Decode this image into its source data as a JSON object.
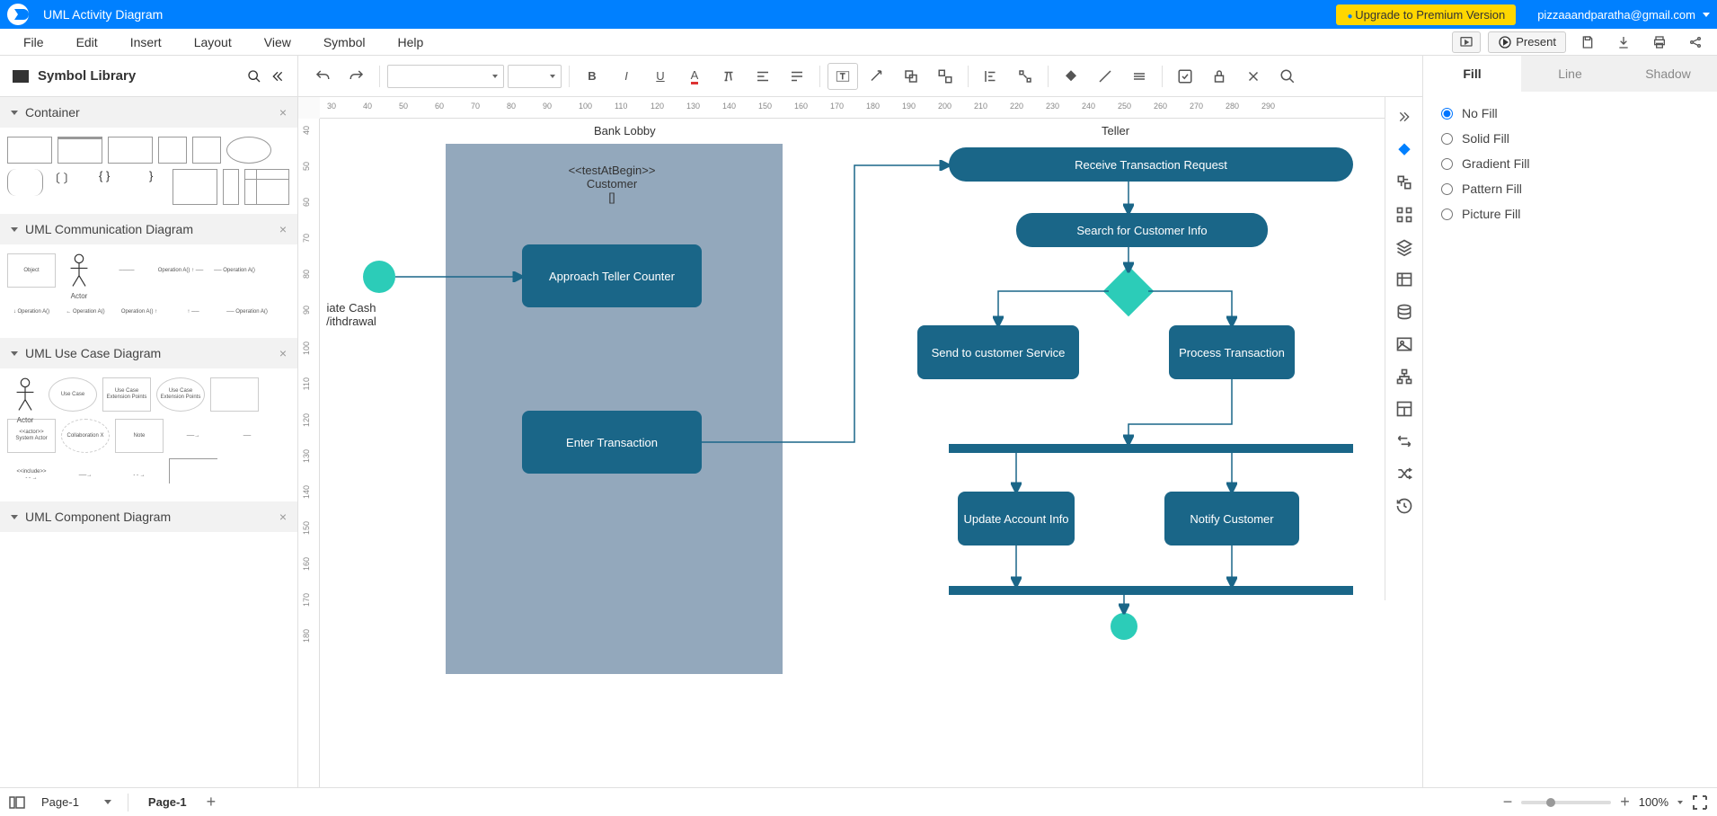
{
  "topbar": {
    "title": "UML Activity Diagram",
    "upgrade": "Upgrade to Premium Version",
    "user": "pizzaaandparatha@gmail.com"
  },
  "menus": [
    "File",
    "Edit",
    "Insert",
    "Layout",
    "View",
    "Symbol",
    "Help"
  ],
  "present_label": "Present",
  "left": {
    "header": "Symbol Library",
    "sections": [
      {
        "name": "Container"
      },
      {
        "name": "UML Communication Diagram"
      },
      {
        "name": "UML Use Case Diagram"
      },
      {
        "name": "UML Component Diagram"
      }
    ]
  },
  "canvas": {
    "lanes": [
      "Bank Lobby",
      "Teller"
    ],
    "test_header": {
      "stereotype": "<<testAtBegin>>",
      "role": "Customer",
      "body": "[]"
    },
    "side_text": {
      "l1": "iate Cash",
      "l2": "/ithdrawal"
    },
    "nodes": {
      "approach": "Approach Teller Counter",
      "enter": "Enter Transaction",
      "receive": "Receive Transaction Request",
      "search": "Search for Customer Info",
      "send": "Send to customer Service",
      "process": "Process Transaction",
      "update": "Update Account Info",
      "notify": "Notify Customer"
    }
  },
  "right_tabs": [
    "Fill",
    "Line",
    "Shadow"
  ],
  "fill_options": [
    "No Fill",
    "Solid Fill",
    "Gradient Fill",
    "Pattern Fill",
    "Picture Fill"
  ],
  "status": {
    "page_sel": "Page-1",
    "page_tab": "Page-1",
    "zoom": "100%"
  },
  "ruler_h": [
    30,
    40,
    50,
    60,
    70,
    80,
    90,
    100,
    110,
    120,
    130,
    140,
    150,
    160,
    170,
    180,
    190,
    200,
    210,
    220,
    230,
    240,
    250,
    260,
    270,
    280,
    290
  ],
  "ruler_v": [
    40,
    50,
    60,
    70,
    80,
    90,
    100,
    110,
    120,
    130,
    140,
    150,
    160,
    170,
    180
  ]
}
